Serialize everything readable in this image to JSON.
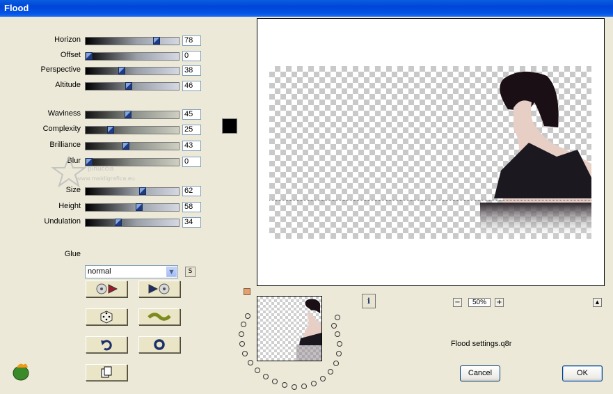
{
  "window": {
    "title": "Flood"
  },
  "sliders": [
    {
      "label": "Horizon",
      "value": "78",
      "level": 78
    },
    {
      "label": "Offset",
      "value": "0",
      "level": 0
    },
    {
      "label": "Perspective",
      "value": "38",
      "level": 38
    },
    {
      "label": "Altitude",
      "value": "46",
      "level": 46
    },
    {
      "label": "Waviness",
      "value": "45",
      "level": 45
    },
    {
      "label": "Complexity",
      "value": "25",
      "level": 25
    },
    {
      "label": "Brilliance",
      "value": "43",
      "level": 43
    },
    {
      "label": "Blur",
      "value": "0",
      "level": 0
    },
    {
      "label": "Size",
      "value": "62",
      "level": 62
    },
    {
      "label": "Height",
      "value": "58",
      "level": 58
    },
    {
      "label": "Undulation",
      "value": "34",
      "level": 34
    }
  ],
  "color": {
    "swatch": "#000000"
  },
  "glue": {
    "label": "Glue",
    "value": "normal",
    "s_button": "S"
  },
  "watermark": {
    "text": "pinuccia",
    "url": "www.maidigrafica.eu"
  },
  "preview": {
    "zoom": "50%"
  },
  "settings_file": "Flood settings.q8r",
  "buttons": {
    "cancel": "Cancel",
    "ok": "OK"
  },
  "icons": {
    "info": "info-icon",
    "plus": "+",
    "minus": "−",
    "scroll_up": "▲"
  }
}
